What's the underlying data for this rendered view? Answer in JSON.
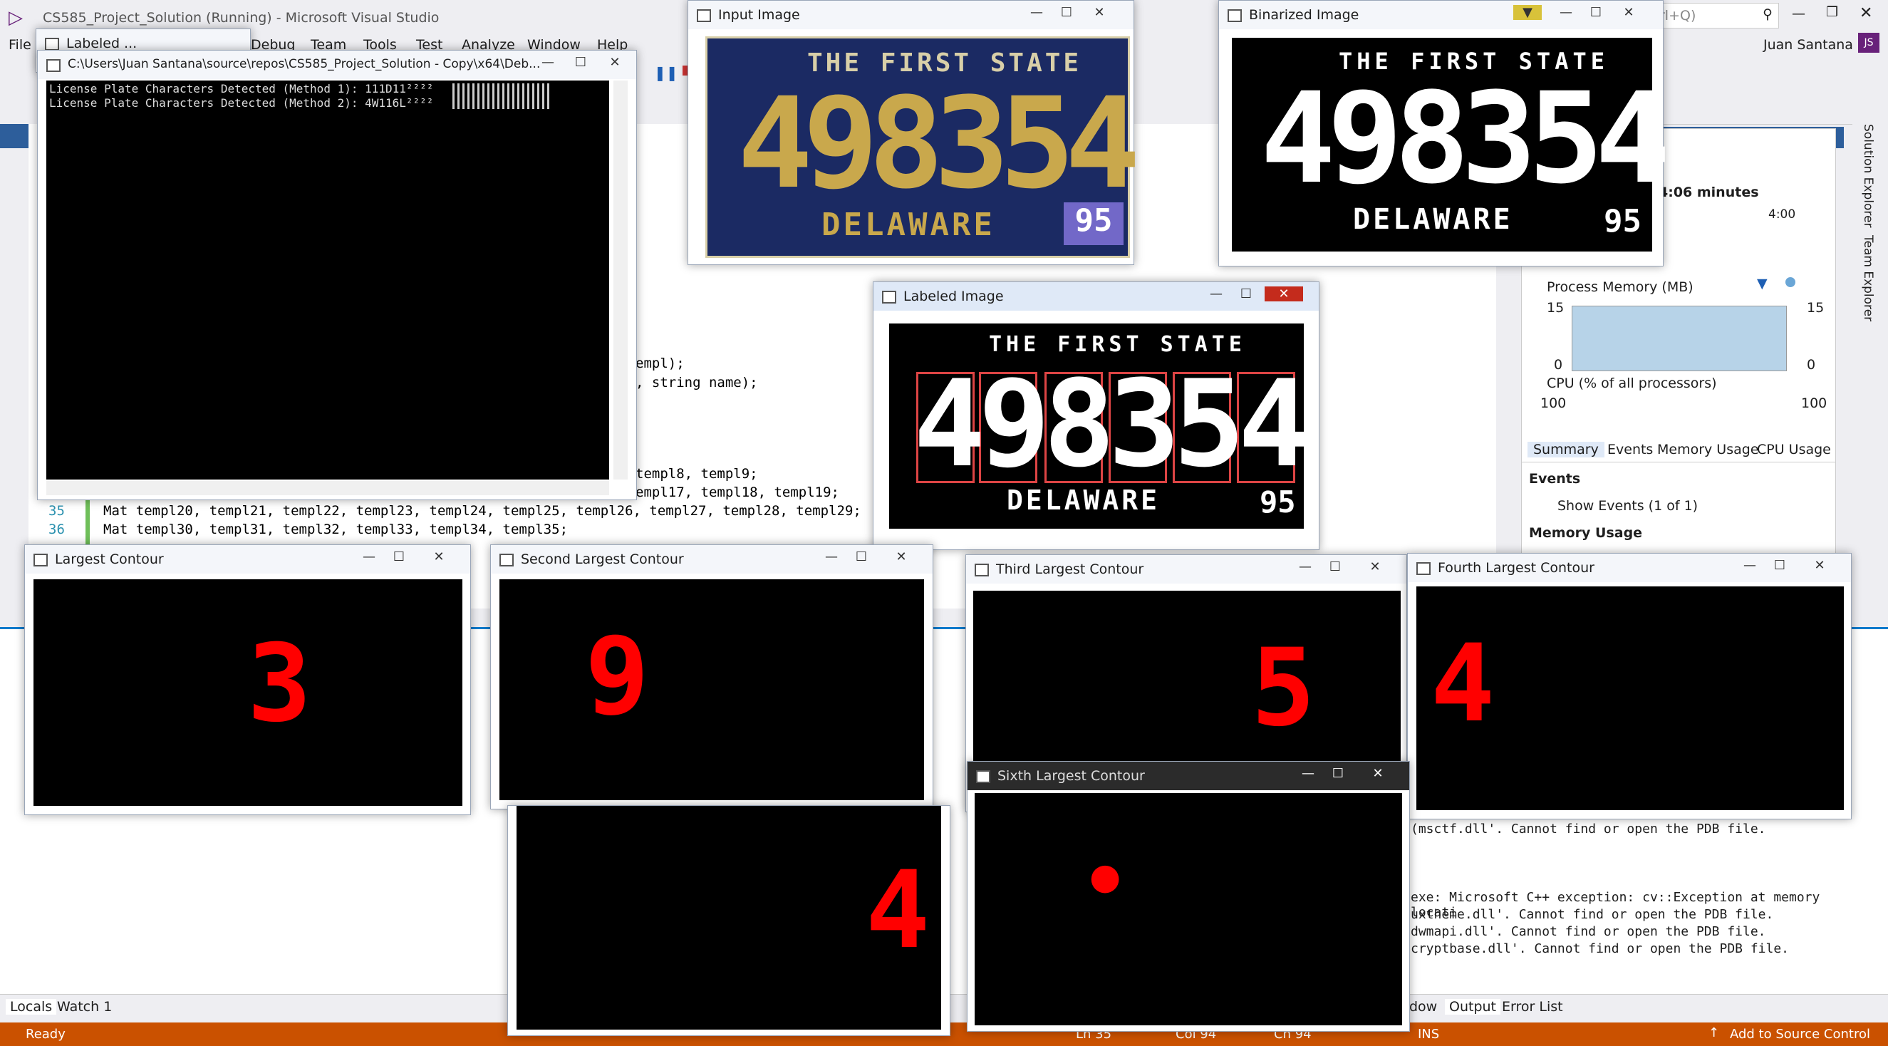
{
  "vs": {
    "title": "CS585_Project_Solution (Running) - Microsoft Visual Studio",
    "menu": [
      "File",
      "Debug",
      "Team",
      "Tools",
      "Test",
      "Analyze",
      "Window",
      "Help"
    ],
    "search_placeholder": "rl+Q)",
    "user": "Juan Santana",
    "user_initials": "JS",
    "side_tabs": [
      "Solution Explorer",
      "Team Explorer"
    ],
    "code_lines": [
      {
        "num": "",
        "text": "empl);"
      },
      {
        "num": "",
        "text": ", string name);"
      },
      {
        "num": "",
        "text": "templ8, templ9;"
      },
      {
        "num": "",
        "text": "empl17, templ18, templ19;"
      },
      {
        "num": "35",
        "text": "Mat templ20, templ21, templ22, templ23, templ24, templ25, templ26, templ27, templ28, templ29;"
      },
      {
        "num": "36",
        "text": "Mat templ30, templ31, templ32, templ33, templ34, templ35;"
      }
    ],
    "diag": {
      "time": "4:06 minutes",
      "time_tick": "4:00",
      "memory_label": "Process Memory (MB)",
      "mem_max": "15",
      "mem_min": "0",
      "cpu_label": "CPU (% of all processors)",
      "cpu_max": "100",
      "tabs": [
        "Summary",
        "Events",
        "Memory Usage",
        "CPU Usage"
      ],
      "events_header": "Events",
      "show_events": "Show Events (1 of 1)",
      "memory_usage_header": "Memory Usage"
    },
    "output_lines": [
      "(msctf.dll'. Cannot find or open the PDB file.",
      "exe: Microsoft C++ exception: cv::Exception at memory locati",
      "uxtheme.dll'. Cannot find or open the PDB file.",
      "dwmapi.dll'. Cannot find or open the PDB file.",
      "cryptbase.dll'. Cannot find or open the PDB file."
    ],
    "bottom_tabs_left": [
      "Locals",
      "Watch 1"
    ],
    "bottom_tabs_right": [
      "dow",
      "Output",
      "Error List"
    ],
    "status": {
      "ready": "Ready",
      "ln": "Ln 35",
      "col": "Col 94",
      "ch": "Ch 94",
      "ins": "INS",
      "source_control": "Add to Source Control"
    }
  },
  "console": {
    "title": "C:\\Users\\Juan Santana\\source\\repos\\CS585_Project_Solution - Copy\\x64\\Deb...",
    "line1": "License Plate Characters Detected (Method 1): 111D11²²²²",
    "line2": "License Plate Characters Detected (Method 2): 4W116L²²²²"
  },
  "labeled_tab": "Labeled ...",
  "windows": {
    "input": "Input Image",
    "binarized": "Binarized Image",
    "labeled": "Labeled Image",
    "largest": "Largest Contour",
    "second": "Second Largest Contour",
    "third": "Third Largest Contour",
    "fourth": "Fourth Largest Contour",
    "sixth": "Sixth Largest Contour"
  },
  "plate": {
    "top": "THE FIRST STATE",
    "number": "498354",
    "bottom": "DELAWARE",
    "sticker": "95"
  },
  "contours": {
    "largest": "3",
    "second": "9",
    "third": "5",
    "fourth": "4",
    "fifth": "4",
    "sixth": "•"
  },
  "colors": {
    "accent": "#007acc",
    "status_bar": "#ca5100",
    "plate_bg": "#1b2a63",
    "plate_gold": "#c9a84c",
    "contour_red": "#ff0000"
  }
}
